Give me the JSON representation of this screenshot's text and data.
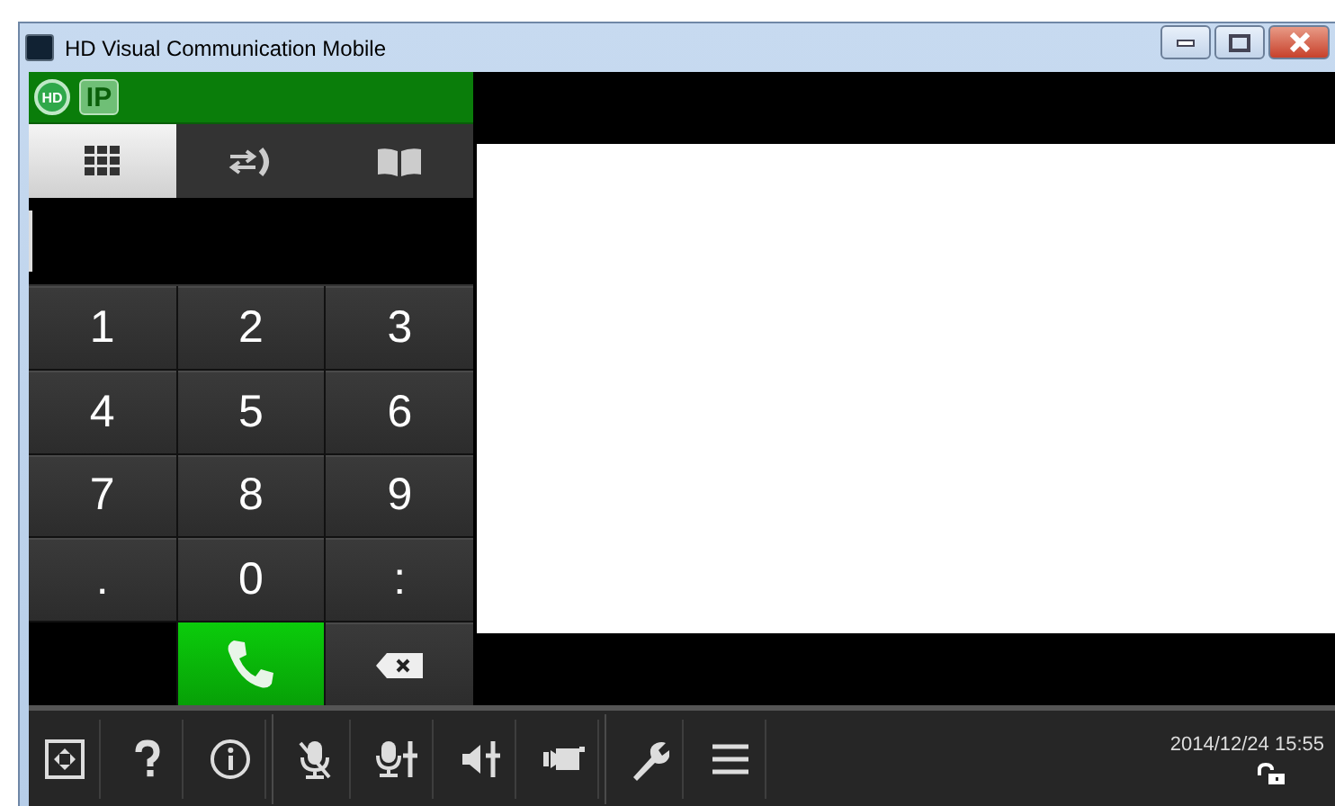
{
  "window": {
    "title": "HD Visual Communication Mobile",
    "controls": [
      {
        "kind": "minimize"
      },
      {
        "kind": "maximize"
      },
      {
        "kind": "close"
      }
    ]
  },
  "status_badges": [
    {
      "kind": "globe",
      "text": "HD"
    },
    {
      "kind": "plain",
      "text": "IP"
    }
  ],
  "tabs": [
    {
      "kind": "keypad",
      "selected": true
    },
    {
      "kind": "transfer",
      "selected": false
    },
    {
      "kind": "book",
      "selected": false
    }
  ],
  "keypad": [
    {
      "kind": "digit",
      "label": "1"
    },
    {
      "kind": "digit",
      "label": "2"
    },
    {
      "kind": "digit",
      "label": "3"
    },
    {
      "kind": "digit",
      "label": "4"
    },
    {
      "kind": "digit",
      "label": "5"
    },
    {
      "kind": "digit",
      "label": "6"
    },
    {
      "kind": "digit",
      "label": "7"
    },
    {
      "kind": "digit",
      "label": "8"
    },
    {
      "kind": "digit",
      "label": "9"
    },
    {
      "kind": "digit",
      "label": "."
    },
    {
      "kind": "digit",
      "label": "0"
    },
    {
      "kind": "digit",
      "label": ":"
    },
    {
      "kind": "blank"
    },
    {
      "kind": "call"
    },
    {
      "kind": "backspace"
    }
  ],
  "toolbar": [
    {
      "kind": "fit"
    },
    {
      "kind": "help"
    },
    {
      "kind": "info"
    },
    {
      "kind": "sep"
    },
    {
      "kind": "mic-mute"
    },
    {
      "kind": "mic-level"
    },
    {
      "kind": "speaker-level"
    },
    {
      "kind": "camera"
    },
    {
      "kind": "sep"
    },
    {
      "kind": "wrench"
    },
    {
      "kind": "menu"
    }
  ],
  "status": {
    "datetime": "2014/12/24 15:55"
  }
}
